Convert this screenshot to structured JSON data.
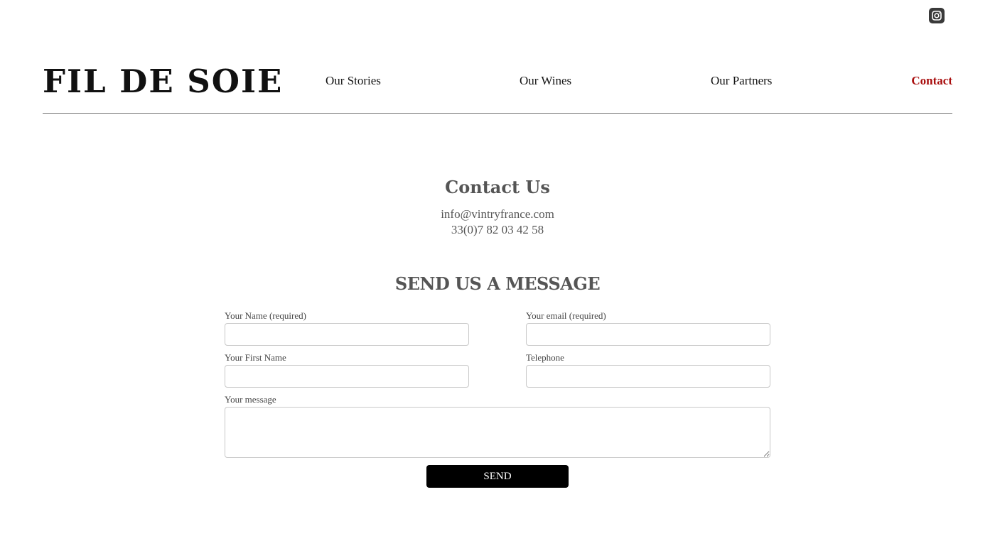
{
  "social": {
    "icon": "instagram-icon"
  },
  "header": {
    "logo": "FIL DE SOIE",
    "nav": [
      {
        "label": "Our Stories",
        "active": false
      },
      {
        "label": "Our Wines",
        "active": false
      },
      {
        "label": "Our Partners",
        "active": false
      },
      {
        "label": "Contact",
        "active": true
      }
    ]
  },
  "contact": {
    "title": "Contact Us",
    "email": "info@vintryfrance.com",
    "phone": "33(0)7 82 03 42 58"
  },
  "form": {
    "title": "SEND US A MESSAGE",
    "fields": {
      "name": {
        "label": "Your Name (required)",
        "value": ""
      },
      "email": {
        "label": "Your email (required)",
        "value": ""
      },
      "first_name": {
        "label": "Your First Name",
        "value": ""
      },
      "telephone": {
        "label": "Telephone",
        "value": ""
      },
      "message": {
        "label": "Your message",
        "value": ""
      }
    },
    "submit_label": "SEND"
  },
  "colors": {
    "active_nav": "#a80d0d",
    "heading_gray": "#555555",
    "button_bg": "#000000",
    "divider": "#7a7a7a"
  }
}
